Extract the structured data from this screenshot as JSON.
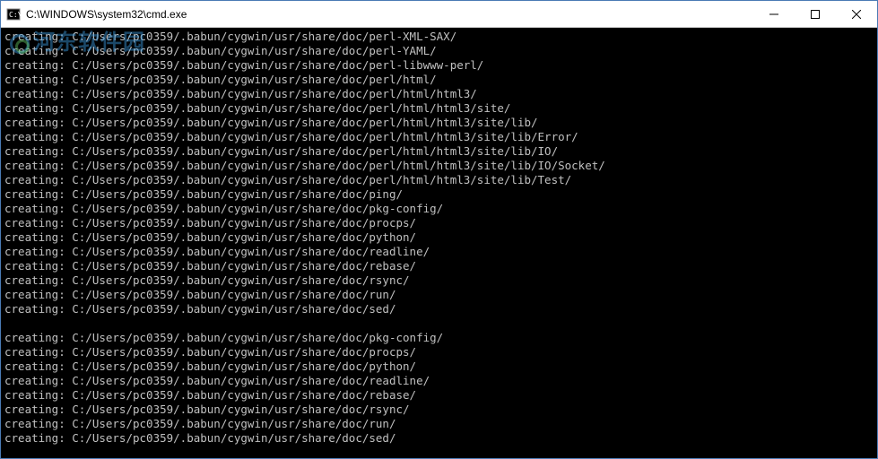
{
  "titlebar": {
    "title": "C:\\WINDOWS\\system32\\cmd.exe"
  },
  "watermark": "河东软件园",
  "terminal": {
    "prefix": "creating: ",
    "block1": [
      "C:/Users/pc0359/.babun/cygwin/usr/share/doc/perl-XML-SAX/",
      "C:/Users/pc0359/.babun/cygwin/usr/share/doc/perl-YAML/",
      "C:/Users/pc0359/.babun/cygwin/usr/share/doc/perl-libwww-perl/",
      "C:/Users/pc0359/.babun/cygwin/usr/share/doc/perl/html/",
      "C:/Users/pc0359/.babun/cygwin/usr/share/doc/perl/html/html3/",
      "C:/Users/pc0359/.babun/cygwin/usr/share/doc/perl/html/html3/site/",
      "C:/Users/pc0359/.babun/cygwin/usr/share/doc/perl/html/html3/site/lib/",
      "C:/Users/pc0359/.babun/cygwin/usr/share/doc/perl/html/html3/site/lib/Error/",
      "C:/Users/pc0359/.babun/cygwin/usr/share/doc/perl/html/html3/site/lib/IO/",
      "C:/Users/pc0359/.babun/cygwin/usr/share/doc/perl/html/html3/site/lib/IO/Socket/",
      "C:/Users/pc0359/.babun/cygwin/usr/share/doc/perl/html/html3/site/lib/Test/",
      "C:/Users/pc0359/.babun/cygwin/usr/share/doc/ping/",
      "C:/Users/pc0359/.babun/cygwin/usr/share/doc/pkg-config/",
      "C:/Users/pc0359/.babun/cygwin/usr/share/doc/procps/",
      "C:/Users/pc0359/.babun/cygwin/usr/share/doc/python/",
      "C:/Users/pc0359/.babun/cygwin/usr/share/doc/readline/",
      "C:/Users/pc0359/.babun/cygwin/usr/share/doc/rebase/",
      "C:/Users/pc0359/.babun/cygwin/usr/share/doc/rsync/",
      "C:/Users/pc0359/.babun/cygwin/usr/share/doc/run/",
      "C:/Users/pc0359/.babun/cygwin/usr/share/doc/sed/"
    ],
    "block2": [
      "C:/Users/pc0359/.babun/cygwin/usr/share/doc/pkg-config/",
      "C:/Users/pc0359/.babun/cygwin/usr/share/doc/procps/",
      "C:/Users/pc0359/.babun/cygwin/usr/share/doc/python/",
      "C:/Users/pc0359/.babun/cygwin/usr/share/doc/readline/",
      "C:/Users/pc0359/.babun/cygwin/usr/share/doc/rebase/",
      "C:/Users/pc0359/.babun/cygwin/usr/share/doc/rsync/",
      "C:/Users/pc0359/.babun/cygwin/usr/share/doc/run/",
      "C:/Users/pc0359/.babun/cygwin/usr/share/doc/sed/"
    ]
  }
}
